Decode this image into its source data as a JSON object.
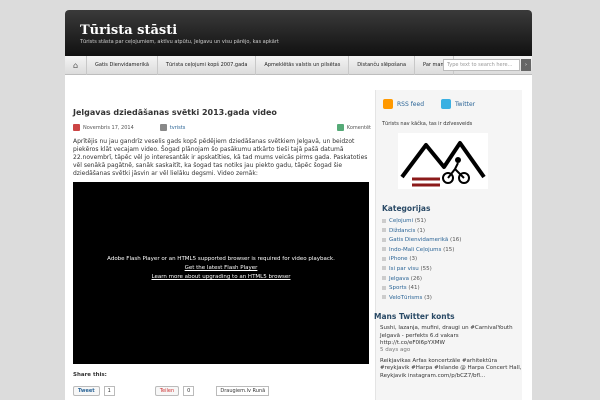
{
  "site": {
    "title": "Tūrista stāsti",
    "description": "Tūrists stāsta par ceļojumiem, aktīvu atpūtu, Jelgavu un visu pārējo, kas apkārt"
  },
  "nav": {
    "items": [
      "Gatis Dienvidamerikā",
      "Tūrista ceļojumi kopš 2007.gada",
      "Apmeklētās valstis un pilsētas",
      "Distanču slēpošana",
      "Par mani"
    ],
    "search_placeholder": "Type text to search here..."
  },
  "post": {
    "title": "Jelgavas dziedāšanas svētki 2013.gada video",
    "date": "Novembris 17, 2014",
    "author": "tvrists",
    "comments": "Komentēt",
    "excerpt": "Aprītējis nu jau gandrīz veselis gads kopš pēdējiem dziedāšanas svētkiem Jelgavā, un beidzot piekēros klāt vecajam video. Šogad plānojam šo pasākumu atkārto tieši tajā pašā datumā 22.novembrī, tāpēc vēl jo interesantāk ir apskatīties, kā tad mums veicās pirms gada. Paskatoties vēl senākā pagātnē, sanāk saskaitīt, ka šogad tas notiks jau piekto gadu, tāpēc šogad šie dziedāšanas svētki jāsvin ar vēl lielāku degsmi. Video zemāk:",
    "video_message": "Adobe Flash Player or an HTML5 supported browser is required for video playback.",
    "video_link1": "Get the latest Flash Player",
    "video_link2": "Learn more about upgrading to an HTML5 browser",
    "share_title": "Share this:",
    "tweet_label": "Tweet",
    "tweet_count": "1",
    "gplus_label": "Teilen",
    "gplus_count": "0",
    "draugiem_label": "Draugiem.lv Runā"
  },
  "sidebar": {
    "rss_label": "RSS feed",
    "twitter_label": "Twitter",
    "logo_caption": "Tūrists nav kāčka, tas ir dzīvesveids",
    "categories_title": "Kategorijas",
    "categories": [
      {
        "name": "Ceļojumi",
        "count": "(51)"
      },
      {
        "name": "Diždancis",
        "count": "(1)"
      },
      {
        "name": "Gatis Dienvidamerikā",
        "count": "(16)"
      },
      {
        "name": "Indo-Mali Ceļojums",
        "count": "(15)"
      },
      {
        "name": "iPhone",
        "count": "(3)"
      },
      {
        "name": "Isi par visu",
        "count": "(55)"
      },
      {
        "name": "Jelgava",
        "count": "(26)"
      },
      {
        "name": "Sports",
        "count": "(41)"
      },
      {
        "name": "VeloTūrisms",
        "count": "(3)"
      }
    ],
    "twitter_title": "Mans Twitter konts",
    "tweets": [
      {
        "text": "Sushi, lazanja, mufini, draugi un #CarnivalYouth Jelgavā - perfekts 6.d vakars http://t.co/eF0I6pYXMW",
        "ago": "5 days ago"
      },
      {
        "text": "Reikjavikas Arfas koncertzāle #arhitektūra #reykjavik #Harpa #Islande @ Harpa Concert Hall, Reykjavik instagram.com/p/bCZ7/bfl..."
      }
    ]
  },
  "colors": {
    "header_dark": "#111111",
    "link": "#2a6496",
    "heading": "#2a4a66"
  }
}
